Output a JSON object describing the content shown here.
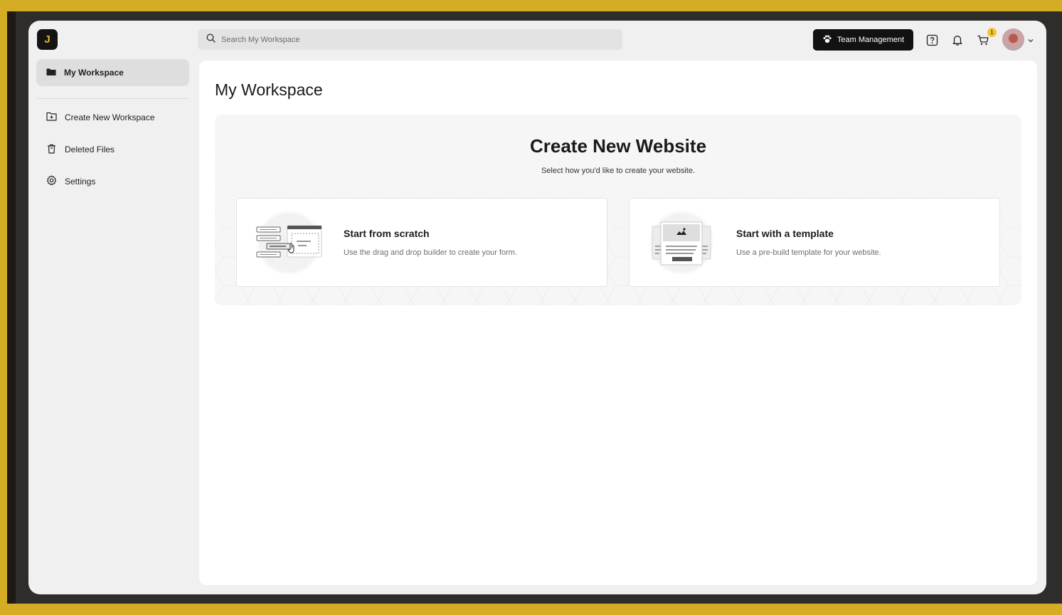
{
  "app": {
    "logo_letter": "J",
    "brand_color": "#e9b92c"
  },
  "search": {
    "placeholder": "Search My Workspace",
    "icon": "search-icon"
  },
  "header": {
    "team_button_label": "Team Management",
    "team_icon": "team-paw-icon",
    "help_icon": "help-icon",
    "bell_icon": "bell-icon",
    "cart_icon": "cart-icon",
    "cart_badge": "1",
    "avatar_icon": "avatar",
    "menu_icon": "chevron-down-icon"
  },
  "sidebar": {
    "items": [
      {
        "label": "My Workspace",
        "icon": "folder-icon",
        "active": true
      },
      {
        "label": "Create New Workspace",
        "icon": "folder-plus-icon",
        "active": false
      },
      {
        "label": "Deleted Files",
        "icon": "trash-icon",
        "active": false
      },
      {
        "label": "Settings",
        "icon": "gear-icon",
        "active": false
      }
    ]
  },
  "main": {
    "title": "My Workspace",
    "create_panel": {
      "title": "Create New Website",
      "subtitle": "Select how you'd like to create your website.",
      "options": [
        {
          "title": "Start from scratch",
          "description": "Use the drag and drop builder to create your form.",
          "icon": "drag-drop-builder-illustration"
        },
        {
          "title": "Start with a template",
          "description": "Use a pre-build template for your website.",
          "icon": "template-illustration"
        }
      ]
    }
  }
}
